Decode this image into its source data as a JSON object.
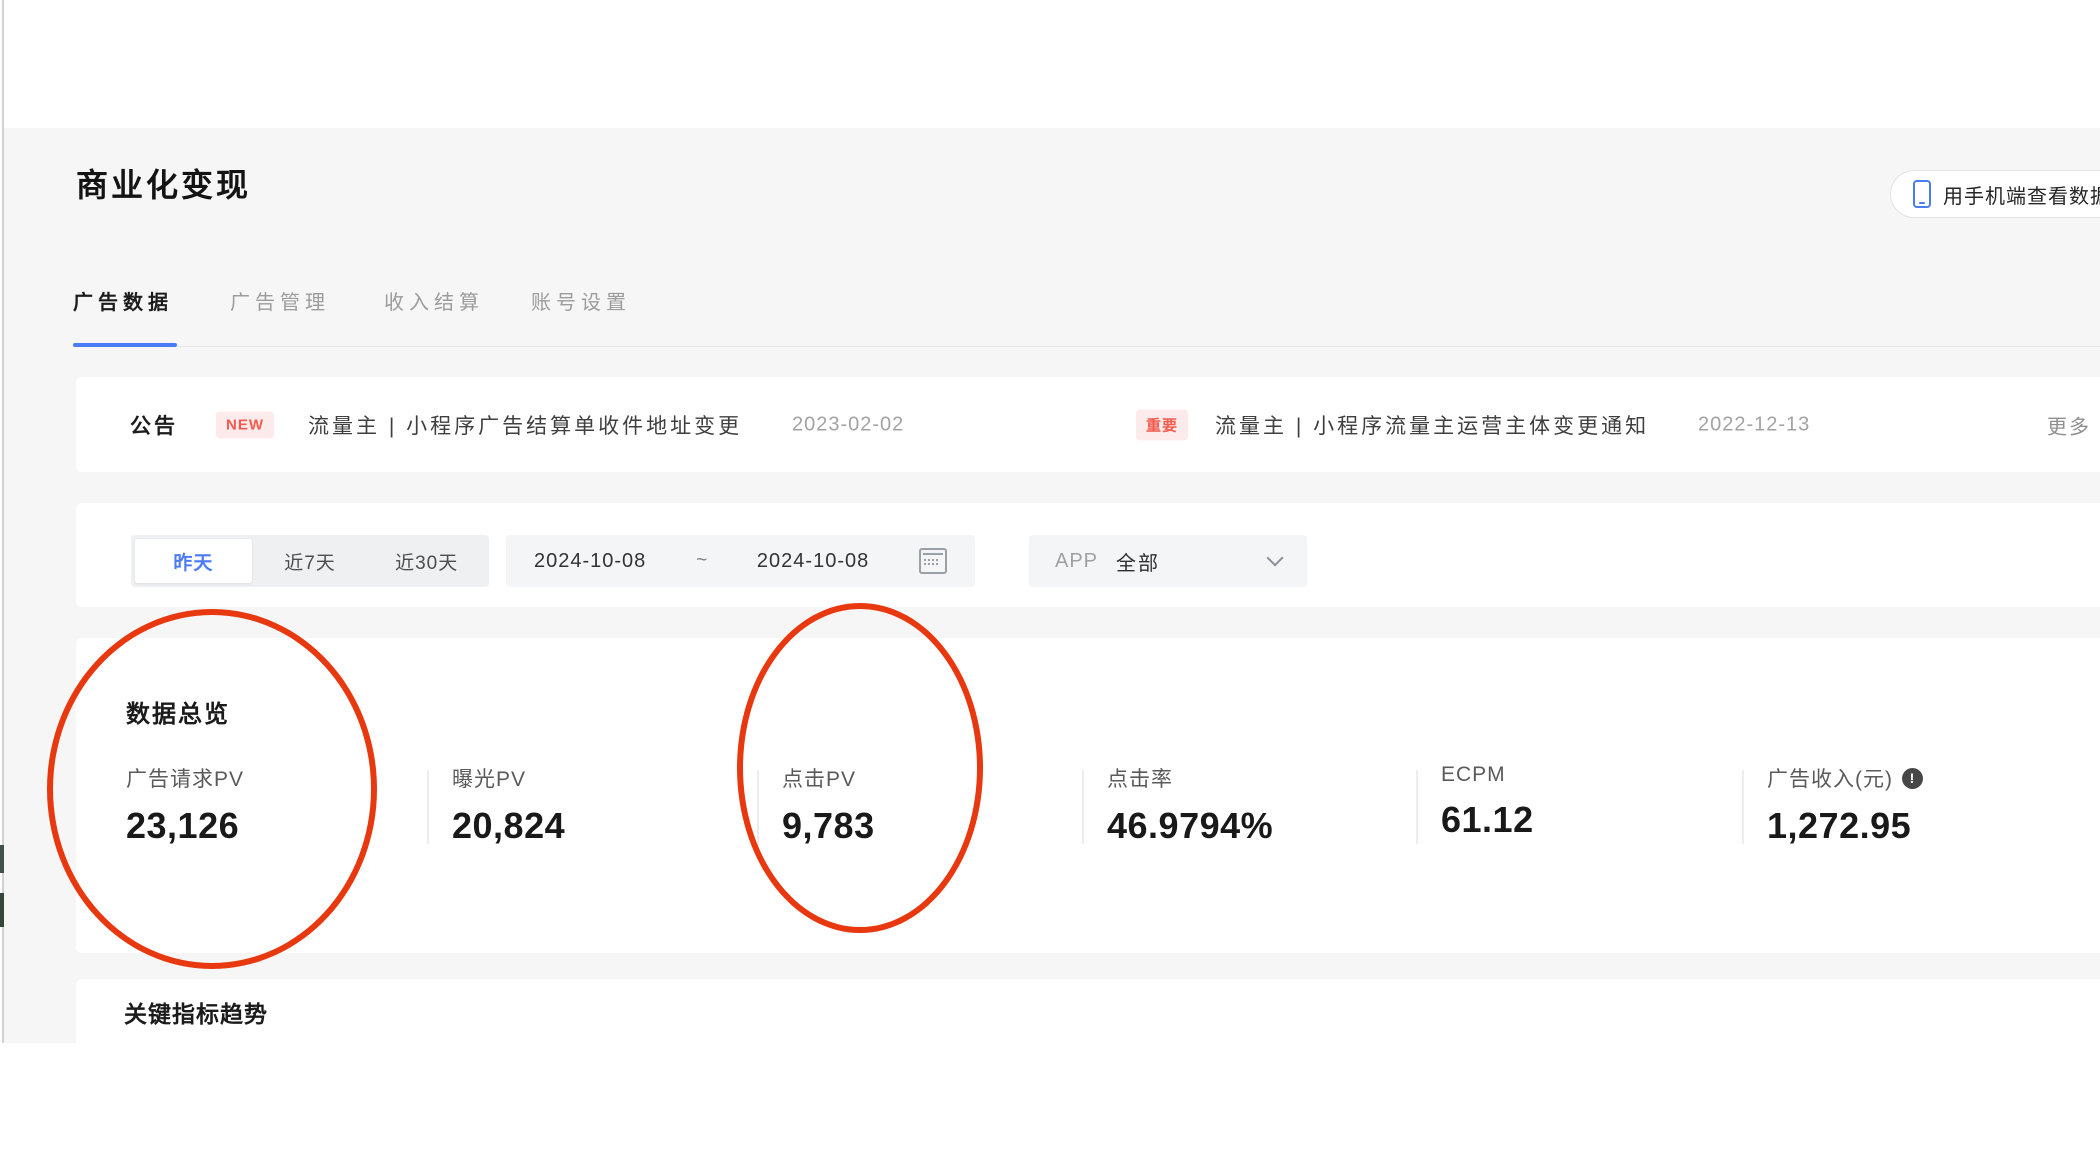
{
  "page": {
    "title": "商业化变现"
  },
  "header": {
    "phone_button": {
      "label": "用手机端查看数据",
      "icon": "phone-icon"
    }
  },
  "tabs": [
    {
      "label": "广告数据",
      "active": true
    },
    {
      "label": "广告管理",
      "active": false
    },
    {
      "label": "收入结算",
      "active": false
    },
    {
      "label": "账号设置",
      "active": false
    }
  ],
  "announcement": {
    "label": "公告",
    "items": [
      {
        "badge": "NEW",
        "text": "流量主 | 小程序广告结算单收件地址变更",
        "date": "2023-02-02"
      },
      {
        "badge": "重要",
        "text": "流量主 | 小程序流量主运营主体变更通知",
        "date": "2022-12-13"
      }
    ],
    "more_label": "更多"
  },
  "filters": {
    "quick_ranges": [
      {
        "label": "昨天",
        "selected": true
      },
      {
        "label": "近7天",
        "selected": false
      },
      {
        "label": "近30天",
        "selected": false
      }
    ],
    "date_range": {
      "start": "2024-10-08",
      "separator": "~",
      "end": "2024-10-08",
      "icon": "calendar-icon"
    },
    "app_select": {
      "label": "APP",
      "value": "全部",
      "icon": "chevron-down-icon"
    }
  },
  "overview": {
    "title": "数据总览",
    "metrics": [
      {
        "label": "广告请求PV",
        "value": "23,126",
        "circled": true
      },
      {
        "label": "曝光PV",
        "value": "20,824",
        "circled": false
      },
      {
        "label": "点击PV",
        "value": "9,783",
        "circled": true
      },
      {
        "label": "点击率",
        "value": "46.9794%",
        "circled": false
      },
      {
        "label": "ECPM",
        "value": "61.12",
        "circled": false
      },
      {
        "label": "广告收入(元)",
        "value": "1,272.95",
        "info_icon": "info-icon",
        "circled": false
      }
    ]
  },
  "trend": {
    "title": "关键指标趋势"
  },
  "annotations": {
    "color": "#e8380f",
    "circles": [
      {
        "around": "广告请求PV 23,126"
      },
      {
        "around": "点击PV 9,783"
      }
    ]
  },
  "colors": {
    "accent_blue": "#4c7cf3",
    "badge_bg": "#fcebea",
    "badge_text": "#f25a4d",
    "band_bg": "#f6f6f7",
    "annotation_red": "#e8380f"
  }
}
